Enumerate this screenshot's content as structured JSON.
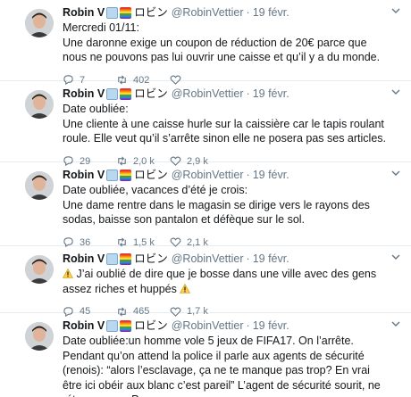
{
  "author": {
    "name": "Robin V",
    "kana": "ロビン",
    "handle": "@RobinVettier",
    "separator": "·"
  },
  "tweets": [
    {
      "date": "19 févr.",
      "lines": [
        "Mercredi 01/11:",
        "Une daronne exige un coupon de réduction de 20€ parce que nous ne pouvons pas lui ouvrir une caisse et qu’il y a du monde."
      ],
      "replies": "7",
      "retweets": "402",
      "likes": ""
    },
    {
      "date": "19 févr.",
      "lines": [
        "Date oubliée:",
        "Une cliente à une caisse hurle sur la caissière car le tapis roulant roule. Elle veut qu’il s’arrête sinon elle ne posera pas ses articles."
      ],
      "replies": "29",
      "retweets": "2,0 k",
      "likes": "2,9 k"
    },
    {
      "date": "19 févr.",
      "lines": [
        "Date oubliée, vacances d’été je crois:",
        "Une dame rentre dans le magasin se dirige vers le rayons des sodas, baisse son pantalon et défèque sur le sol."
      ],
      "replies": "36",
      "retweets": "1,5 k",
      "likes": "2,1 k"
    },
    {
      "date": "19 févr.",
      "lines": [
        "J’ai oublié de dire que je bosse dans une ville avec des gens assez riches et huppés"
      ],
      "replies": "45",
      "retweets": "465",
      "likes": "1,7 k"
    },
    {
      "date": "19 févr.",
      "lines": [
        "Date oubliée:un homme vole 5 jeux de FIFA17. On l’arrête. Pendant qu’on attend la police il parle aux agents de sécurité (renois): “alors l’esclavage, ça ne te manque pas trop? En vrai être ici obéir aux blanc c’est pareil” L’agent de sécurité sourit, ne rétorque pas. Propre."
      ],
      "replies": "",
      "retweets": "",
      "likes": ""
    }
  ],
  "colors": {
    "text": "#14171a",
    "muted": "#657786",
    "divider": "#e6ecf0"
  },
  "icons": {
    "reply": "reply-icon",
    "retweet": "retweet-icon",
    "like": "heart-icon",
    "caret": "chevron-down-icon",
    "warning": "warning-icon"
  }
}
